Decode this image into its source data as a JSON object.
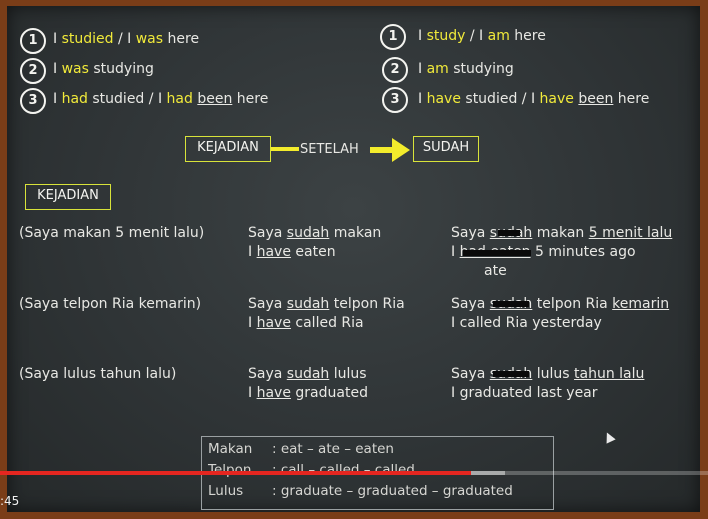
{
  "row1": {
    "num": "1",
    "left": {
      "a": "I ",
      "b": "studied",
      "c": " / I ",
      "d": "was",
      "e": " here"
    },
    "right": {
      "a": "I ",
      "b": "study",
      "c": " / I ",
      "d": "am",
      "e": " here"
    }
  },
  "row2": {
    "num": "2",
    "left": {
      "a": "I ",
      "b": "was",
      "c": " studying"
    },
    "right": {
      "a": "I ",
      "b": "am",
      "c": " studying"
    }
  },
  "row3": {
    "num": "3",
    "left": {
      "a": "I ",
      "b": "had",
      "c": " studied  / I ",
      "d": "had",
      "e": " ",
      "f": "been",
      "g": " here"
    },
    "right": {
      "a": "I ",
      "b": "have",
      "c": " studied / I ",
      "d": "have",
      "e": " ",
      "f": "been",
      "g": " here"
    }
  },
  "flow": {
    "kejadian": "KEJADIAN",
    "setelah": "SETELAH",
    "sudah": "SUDAH"
  },
  "section_label": "KEJADIAN",
  "examples": [
    {
      "cond": "(Saya makan 5 menit lalu)",
      "mid1a": "Saya ",
      "mid1b": "sudah",
      "mid1c": " makan",
      "mid2a": "I ",
      "mid2b": "have",
      "mid2c": " eaten",
      "r1a": "Saya ",
      "r1b": "sudah",
      "r1c": " makan ",
      "r1d": "5 menit lalu",
      "r2a": "I ",
      "r2b": "had eaten",
      "r2c": " 5 minutes ago",
      "r3": "ate"
    },
    {
      "cond": "(Saya telpon Ria kemarin)",
      "mid1a": "Saya ",
      "mid1b": "sudah",
      "mid1c": " telpon Ria",
      "mid2a": "I ",
      "mid2b": "have",
      "mid2c": " called Ria",
      "r1a": "Saya ",
      "r1b": "sudah",
      "r1c": " telpon Ria ",
      "r1d": "kemarin",
      "r2": "I called Ria yesterday"
    },
    {
      "cond": "(Saya lulus tahun lalu)",
      "mid1a": "Saya ",
      "mid1b": "sudah",
      "mid1c": " lulus",
      "mid2a": "I ",
      "mid2b": "have",
      "mid2c": " graduated",
      "r1a": "Saya ",
      "r1b": "sudah",
      "r1c": " lulus ",
      "r1d": "tahun lalu",
      "r2": "I graduated last year"
    }
  ],
  "legend": [
    {
      "word": "Makan",
      "forms": ": eat – ate – eaten"
    },
    {
      "word": "Telpon",
      "forms": ": call – called – called"
    },
    {
      "word": "Lulus",
      "forms": ": graduate – graduated – graduated"
    }
  ],
  "player": {
    "time": ":45",
    "progress": 0.665,
    "buffered": 0.713,
    "progress_color": "#e52620"
  }
}
